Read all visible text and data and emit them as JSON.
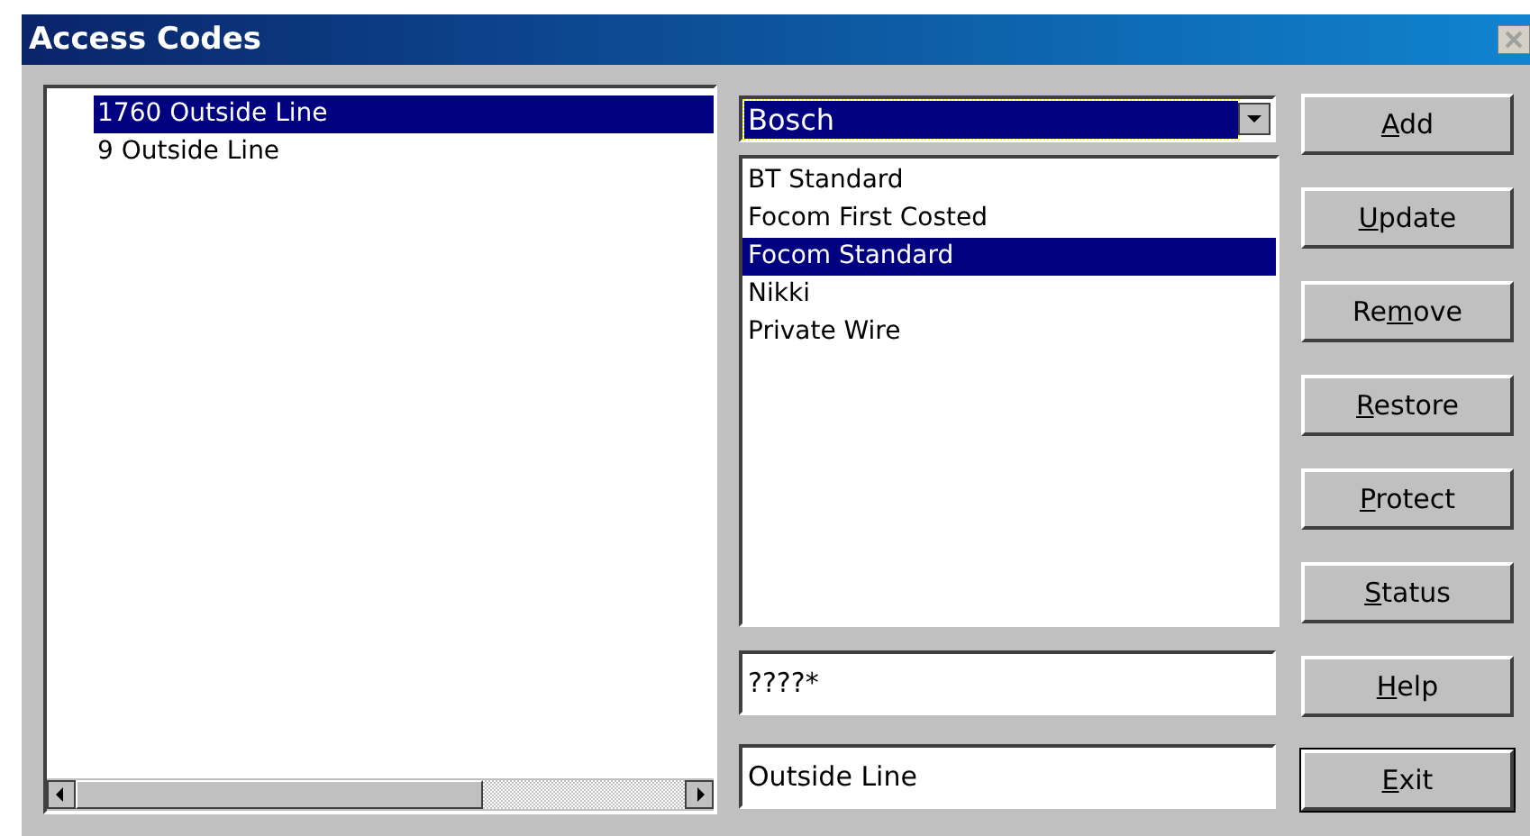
{
  "window": {
    "title": "Access Codes"
  },
  "codes": [
    {
      "label": "1760 Outside Line",
      "selected": true
    },
    {
      "label": "9 Outside Line",
      "selected": false
    }
  ],
  "carrier": {
    "value": "Bosch"
  },
  "tariffs": [
    {
      "label": "BT Standard",
      "selected": false
    },
    {
      "label": "Focom First Costed",
      "selected": false
    },
    {
      "label": "Focom Standard",
      "selected": true
    },
    {
      "label": "Nikki",
      "selected": false
    },
    {
      "label": "Private Wire",
      "selected": false
    }
  ],
  "pattern_field": {
    "value": "????*"
  },
  "name_field": {
    "value": "Outside Line"
  },
  "buttons": [
    {
      "key": "A",
      "after": "dd",
      "default": false
    },
    {
      "key": "U",
      "after": "pdate",
      "default": false
    },
    {
      "before": "Re",
      "key": "m",
      "after": "ove",
      "default": false
    },
    {
      "key": "R",
      "after": "estore",
      "default": false
    },
    {
      "key": "P",
      "after": "rotect",
      "default": false
    },
    {
      "key": "S",
      "after": "tatus",
      "default": false
    },
    {
      "key": "H",
      "after": "elp",
      "default": false
    },
    {
      "key": "E",
      "after": "xit",
      "default": true
    }
  ]
}
